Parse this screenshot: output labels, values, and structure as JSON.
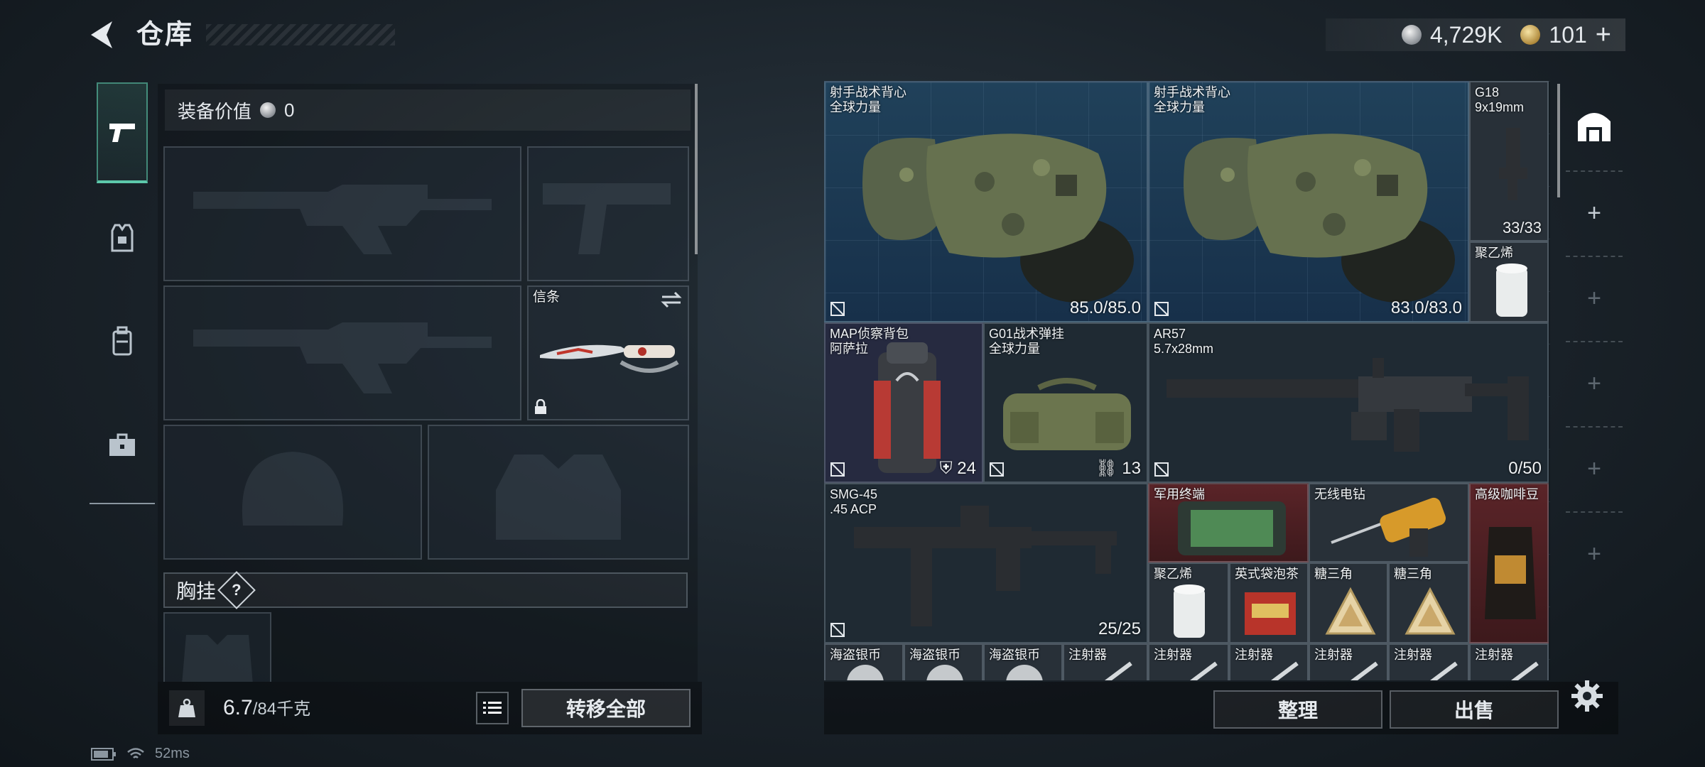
{
  "header": {
    "title": "仓库"
  },
  "currency": {
    "silver": "4,729K",
    "gold": "101",
    "gold_plus": "+"
  },
  "nav": {
    "items": [
      "pistol-icon",
      "vest-icon",
      "backpack-icon",
      "toolbox-icon"
    ],
    "active": 0
  },
  "loadout": {
    "equip_value_label": "装备价值",
    "equip_value": "0",
    "knife_label": "信条",
    "chest_label": "胸挂",
    "help_mark": "?"
  },
  "bottom_left": {
    "weight_current": "6.7",
    "weight_max": "/84千克",
    "transfer_all": "转移全部"
  },
  "storage": {
    "items": [
      {
        "name1": "射手战术背心",
        "name2": "全球力量",
        "value": "85.0/85.0",
        "color": "blue"
      },
      {
        "name1": "射手战术背心",
        "name2": "全球力量",
        "value": "83.0/83.0",
        "color": "blue"
      },
      {
        "name1": "G18",
        "name2": "9x19mm",
        "value": "33/33",
        "color": "grey"
      },
      {
        "name1": "聚乙烯",
        "name2": "",
        "value": "",
        "color": "grey"
      },
      {
        "name1": "MAP侦察背包",
        "name2": "阿萨拉",
        "value": "24",
        "color": "purple"
      },
      {
        "name1": "G01战术弹挂",
        "name2": "全球力量",
        "value": "13",
        "color": "dark"
      },
      {
        "name1": "AR57",
        "name2": "5.7x28mm",
        "value": "0/50",
        "color": "dark"
      },
      {
        "name1": "SMG-45",
        "name2": ".45 ACP",
        "value": "25/25",
        "color": "dark"
      },
      {
        "name1": "军用终端",
        "name2": "",
        "value": "",
        "color": "red"
      },
      {
        "name1": "无线电钻",
        "name2": "",
        "value": "",
        "color": "grey"
      },
      {
        "name1": "高级咖啡豆",
        "name2": "",
        "value": "",
        "color": "red"
      },
      {
        "name1": "聚乙烯",
        "name2": "",
        "value": "",
        "color": "grey"
      },
      {
        "name1": "英式袋泡茶",
        "name2": "",
        "value": "",
        "color": "grey"
      },
      {
        "name1": "糖三角",
        "name2": "",
        "value": "",
        "color": "grey"
      },
      {
        "name1": "糖三角",
        "name2": "",
        "value": "",
        "color": "grey"
      },
      {
        "name1": "海盗银币",
        "name2": "",
        "value": "",
        "color": "grey"
      },
      {
        "name1": "海盗银币",
        "name2": "",
        "value": "",
        "color": "grey"
      },
      {
        "name1": "海盗银币",
        "name2": "",
        "value": "",
        "color": "grey"
      },
      {
        "name1": "注射器",
        "name2": "",
        "value": "",
        "color": "grey"
      },
      {
        "name1": "注射器",
        "name2": "",
        "value": "",
        "color": "grey"
      },
      {
        "name1": "注射器",
        "name2": "",
        "value": "",
        "color": "grey"
      },
      {
        "name1": "注射器",
        "name2": "",
        "value": "",
        "color": "grey"
      },
      {
        "name1": "注射器",
        "name2": "",
        "value": "",
        "color": "grey"
      },
      {
        "name1": "注射器",
        "name2": "",
        "value": "",
        "color": "grey"
      }
    ]
  },
  "side": {
    "plus": "+"
  },
  "bottom_right": {
    "sort": "整理",
    "sell": "出售"
  },
  "status": {
    "ping": "52ms"
  }
}
